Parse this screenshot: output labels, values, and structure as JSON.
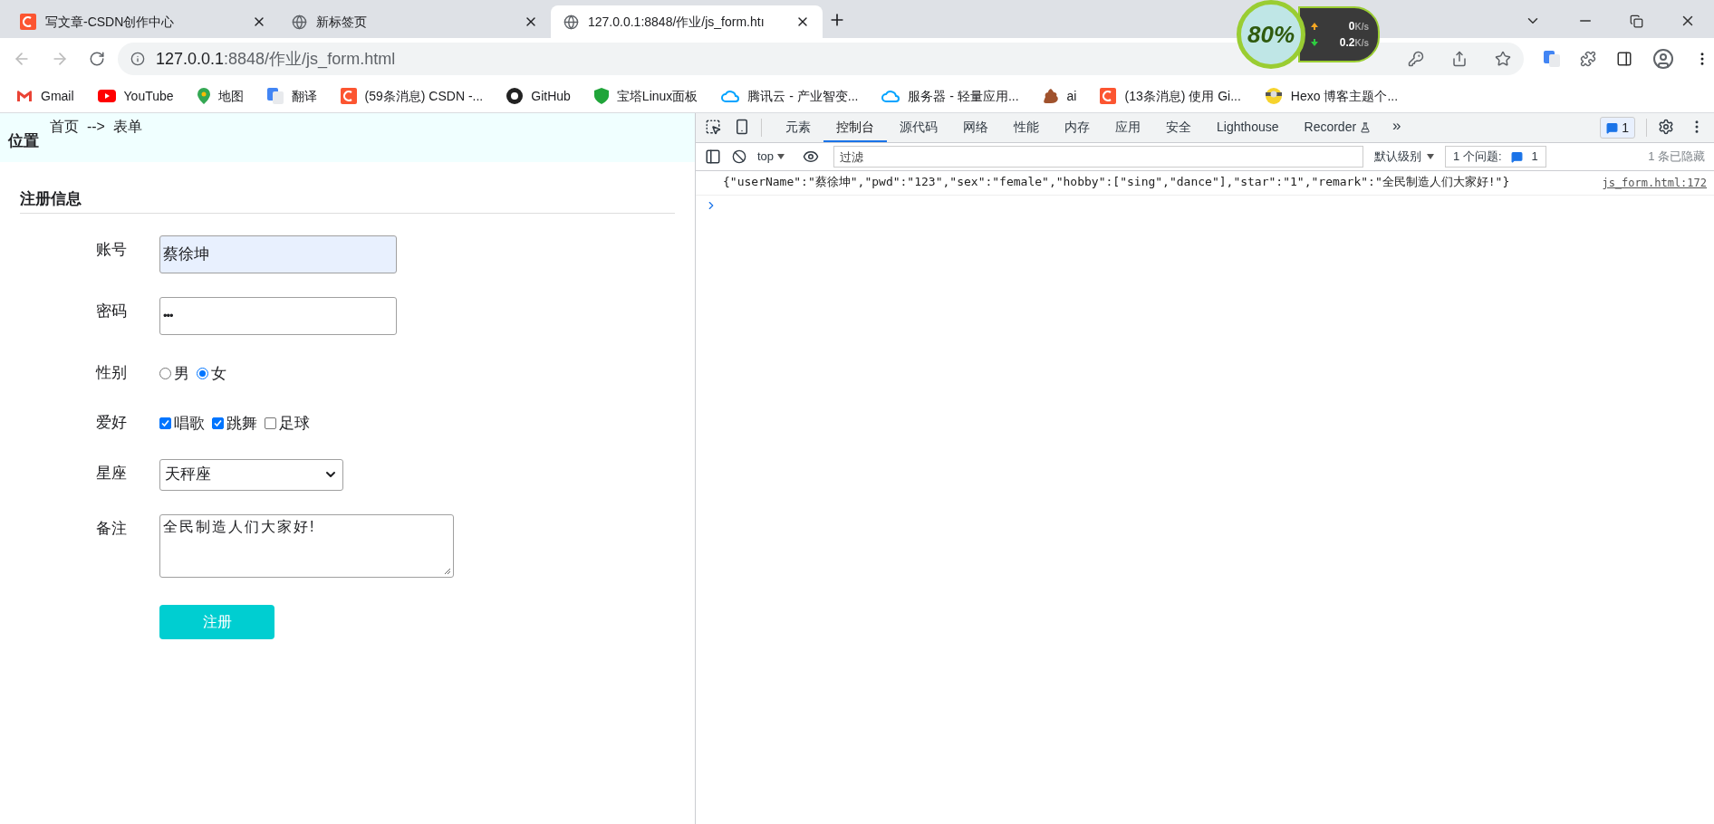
{
  "browser_tabs": [
    {
      "title": "写文章-CSDN创作中心",
      "selected": false
    },
    {
      "title": "新标签页",
      "selected": false
    },
    {
      "title": "127.0.0.1:8848/作业/js_form.htı",
      "selected": true
    }
  ],
  "address_bar": {
    "host": "127.0.0.1",
    "path": ":8848/作业/js_form.html"
  },
  "net_monitor": {
    "percent": "80%",
    "up": "0",
    "up_unit": "K/s",
    "down": "0.2",
    "down_unit": "K/s"
  },
  "bookmarks": [
    {
      "label": "Gmail"
    },
    {
      "label": "YouTube"
    },
    {
      "label": "地图"
    },
    {
      "label": "翻译"
    },
    {
      "label": "(59条消息) CSDN -..."
    },
    {
      "label": "GitHub"
    },
    {
      "label": "宝塔Linux面板"
    },
    {
      "label": "腾讯云 - 产业智变..."
    },
    {
      "label": "服务器 - 轻量应用..."
    },
    {
      "label": "ai"
    },
    {
      "label": "(13条消息) 使用 Gi..."
    },
    {
      "label": "Hexo 博客主题个..."
    }
  ],
  "page": {
    "location_label": "位置",
    "breadcrumb": "首页  -->  表单",
    "section_title": "注册信息",
    "fields": [
      {
        "kind": "text",
        "label": "账号",
        "value": "蔡徐坤",
        "autofilled": true
      },
      {
        "kind": "password",
        "label": "密码",
        "value": "•••",
        "autofilled": false
      },
      {
        "kind": "radio",
        "label": "性别",
        "options": [
          {
            "label": "男",
            "selected": false
          },
          {
            "label": "女",
            "selected": true
          }
        ]
      },
      {
        "kind": "checkbox",
        "label": "爱好",
        "options": [
          {
            "label": "唱歌",
            "checked": true
          },
          {
            "label": "跳舞",
            "checked": true
          },
          {
            "label": "足球",
            "checked": false
          }
        ]
      },
      {
        "kind": "select",
        "label": "星座",
        "value": "天秤座"
      },
      {
        "kind": "textarea",
        "label": "备注",
        "value": "全民制造人们大家好!"
      }
    ],
    "submit": "注册"
  },
  "devtools": {
    "tabs": [
      {
        "label": "元素",
        "selected": false
      },
      {
        "label": "控制台",
        "selected": true
      },
      {
        "label": "源代码",
        "selected": false
      },
      {
        "label": "网络",
        "selected": false
      },
      {
        "label": "性能",
        "selected": false
      },
      {
        "label": "内存",
        "selected": false
      },
      {
        "label": "应用",
        "selected": false
      },
      {
        "label": "安全",
        "selected": false
      },
      {
        "label": "Lighthouse",
        "selected": false
      },
      {
        "label": "Recorder",
        "selected": false
      }
    ],
    "more_tabs": "»",
    "issues_badge": "1",
    "context": "top",
    "filter_placeholder": "过滤",
    "levels": "默认级别",
    "issues_label": "1 个问题:",
    "issues_count": "1",
    "hidden": "1 条已隐藏",
    "log": {
      "message": "{\"userName\":\"蔡徐坤\",\"pwd\":\"123\",\"sex\":\"female\",\"hobby\":[\"sing\",\"dance\"],\"star\":\"1\",\"remark\":\"全民制造人们大家好!\"}",
      "source": "js_form.html:172"
    }
  }
}
